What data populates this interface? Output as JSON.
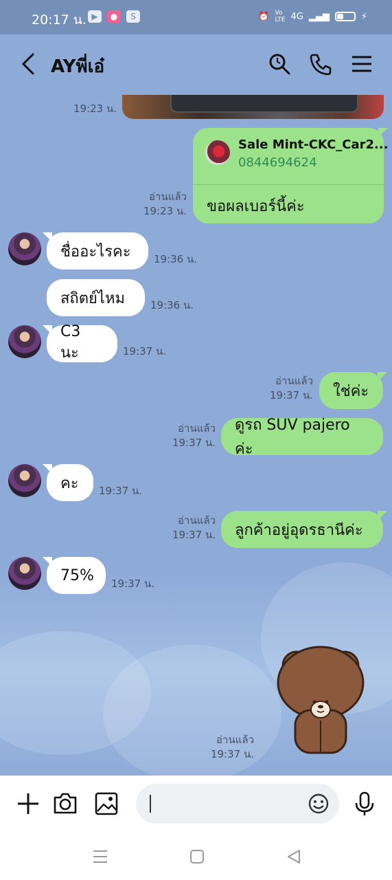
{
  "status_bar": {
    "time": "20:17 น.",
    "app_icons": [
      "youtube-icon",
      "line-icon",
      "s-app-icon"
    ],
    "network_label": "4G",
    "battery_fraction": 0.35
  },
  "header": {
    "contact_name": "AYพี่เอ๋",
    "icons": [
      "back-icon",
      "search-icon",
      "phone-icon",
      "menu-icon"
    ]
  },
  "messages": {
    "photo_time": "19:23 น.",
    "contact_card": {
      "name": "Sale Mint-CKC_Car2...",
      "phone": "0844694624",
      "text": "ขอผลเบอร์นี้ค่ะ",
      "read": "อ่านแล้ว",
      "time": "19:23 น."
    },
    "m1": {
      "text": "ชื่ออะไรคะ",
      "time": "19:36 น."
    },
    "m2": {
      "text": "สถิตย์ไหม",
      "time": "19:36 น."
    },
    "m3": {
      "text": "C3 นะ",
      "time": "19:37 น."
    },
    "m4": {
      "text": "ใช่ค่ะ",
      "read": "อ่านแล้ว",
      "time": "19:37 น."
    },
    "m5": {
      "text": "ดูรถ SUV pajero ค่ะ",
      "read": "อ่านแล้ว",
      "time": "19:37 น."
    },
    "m6": {
      "text": "คะ",
      "time": "19:37 น."
    },
    "m7": {
      "text": "ลูกค้าอยู่อุดรธานีค่ะ",
      "read": "อ่านแล้ว",
      "time": "19:37 น."
    },
    "m8": {
      "text": "75%",
      "time": "19:37 น."
    },
    "sticker": {
      "name": "brown-bear-sticker",
      "read": "อ่านแล้ว",
      "time": "19:37 น."
    }
  },
  "input_bar": {
    "icons": [
      "plus-icon",
      "camera-icon",
      "gallery-icon",
      "emoji-icon",
      "microphone-icon"
    ],
    "value": ""
  },
  "nav_bar": {
    "icons": [
      "recent-apps-icon",
      "home-icon",
      "back-nav-icon"
    ]
  },
  "colors": {
    "chat_bg": "#8eabd8",
    "outgoing": "#9ce28b",
    "incoming": "#ffffff",
    "status_bar": "#7590b8"
  }
}
